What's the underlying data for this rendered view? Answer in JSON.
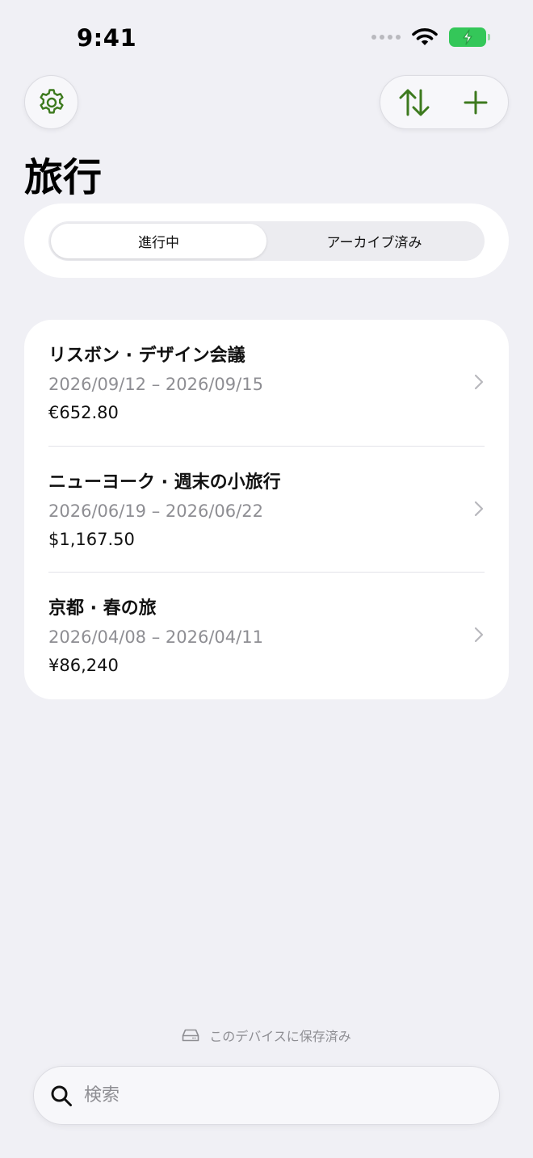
{
  "status_bar": {
    "time": "9:41"
  },
  "header": {
    "title": "旅行",
    "settings_icon": "gear-icon",
    "sort_icon": "sort-arrows-icon",
    "add_icon": "plus-icon"
  },
  "segment": {
    "options": [
      "進行中",
      "アーカイブ済み"
    ],
    "selected": "進行中"
  },
  "trips": [
    {
      "title": "リスボン · デザイン会議",
      "dates": "2026/09/12 – 2026/09/15",
      "amount": "€652.80"
    },
    {
      "title": "ニューヨーク · 週末の小旅行",
      "dates": "2026/06/19 – 2026/06/22",
      "amount": "$1,167.50"
    },
    {
      "title": "京都 · 春の旅",
      "dates": "2026/04/08 – 2026/04/11",
      "amount": "¥86,240"
    }
  ],
  "footer": {
    "storage_note": "このデバイスに保存済み",
    "search_placeholder": "検索"
  },
  "colors": {
    "accent": "#3d7a1e",
    "background": "#f0f0f5",
    "battery": "#34c759",
    "secondary_text": "#8e8e93"
  }
}
